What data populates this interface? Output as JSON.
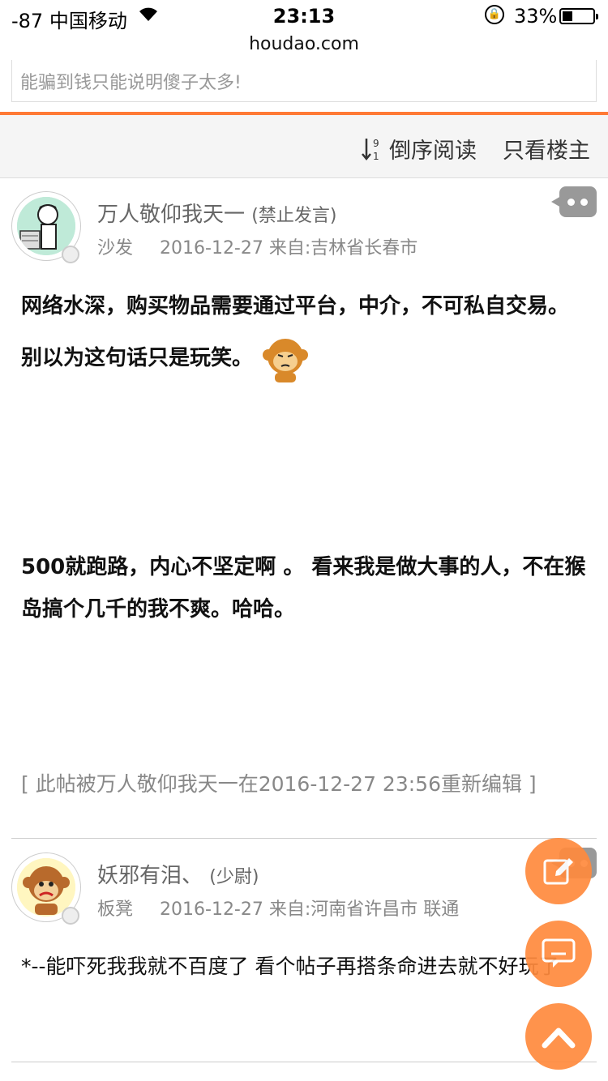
{
  "status_bar": {
    "carrier": "-87 中国移动",
    "time": "23:13",
    "battery": "33%"
  },
  "url": "houdao.com",
  "previous_post": {
    "text": "能骗到钱只能说明傻子太多!"
  },
  "toolbar": {
    "reverse_label": "倒序阅读",
    "owner_only_label": "只看楼主"
  },
  "posts": [
    {
      "username": "万人敬仰我天一",
      "role": "(禁止发言)",
      "floor": "沙发",
      "datetime": "2016-12-27",
      "location": "来自:吉林省长春市",
      "paragraph1": "网络水深，购买物品需要通过平台，中介，不可私自交易。别以为这句话只是玩笑。",
      "paragraph2": "500就跑路，内心不坚定啊 。 看来我是做大事的人，不在猴岛搞个几千的我不爽。哈哈。",
      "edit_note": "[ 此帖被万人敬仰我天一在2016-12-27 23:56重新编辑 ]"
    },
    {
      "username": "妖邪有泪、",
      "role": "(少尉)",
      "floor": "板凳",
      "datetime": "2016-12-27",
      "location": "来自:河南省许昌市 联通",
      "content": "*--能吓死我我就不百度了 看个帖子再搭条命进去就不好玩了"
    }
  ],
  "colors": {
    "accent": "#ff7a35",
    "fab": "#ff8a3d"
  },
  "icons": {
    "sort": "sort-desc-icon",
    "message": "message-bubble-icon",
    "edit": "edit-icon",
    "reply": "reply-icon",
    "top": "chevron-up-icon"
  }
}
